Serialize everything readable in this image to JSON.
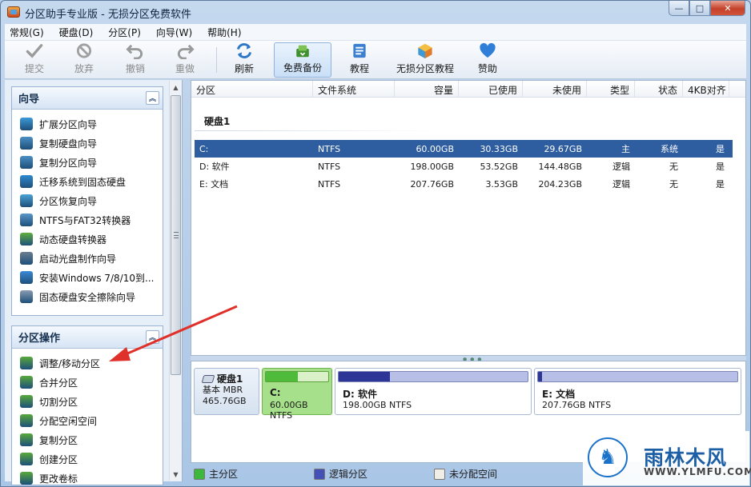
{
  "window": {
    "title": "分区助手专业版 - 无损分区免费软件",
    "min_glyph": "—",
    "max_glyph": "□",
    "close_glyph": "✕"
  },
  "menu": [
    "常规(G)",
    "硬盘(D)",
    "分区(P)",
    "向导(W)",
    "帮助(H)"
  ],
  "toolbar": {
    "commit": "提交",
    "discard": "放弃",
    "undo": "撤销",
    "redo": "重做",
    "refresh": "刷新",
    "backup": "免费备份",
    "tutorial": "教程",
    "lossless_tutorial": "无损分区教程",
    "donate": "赞助"
  },
  "wizard": {
    "title": "向导",
    "collapse_glyph": "︽",
    "items": [
      {
        "label": "扩展分区向导",
        "icon": "extend-partition-icon",
        "color": "#3d9ad8"
      },
      {
        "label": "复制硬盘向导",
        "icon": "copy-disk-icon",
        "color": "#4b8fc4"
      },
      {
        "label": "复制分区向导",
        "icon": "copy-partition-icon",
        "color": "#4b8fc4"
      },
      {
        "label": "迁移系统到固态硬盘",
        "icon": "migrate-ssd-icon",
        "color": "#2f8ad1"
      },
      {
        "label": "分区恢复向导",
        "icon": "partition-recovery-icon",
        "color": "#4aa3d6"
      },
      {
        "label": "NTFS与FAT32转换器",
        "icon": "ntfs-fat32-icon",
        "color": "#5a97c9"
      },
      {
        "label": "动态硬盘转换器",
        "icon": "dynamic-disk-icon",
        "color": "#5fae3c"
      },
      {
        "label": "启动光盘制作向导",
        "icon": "boot-cd-icon",
        "color": "#6c7d90"
      },
      {
        "label": "安装Windows 7/8/10到...",
        "icon": "windows-install-icon",
        "color": "#3b89d6"
      },
      {
        "label": "固态硬盘安全擦除向导",
        "icon": "ssd-erase-icon",
        "color": "#8a9bb0"
      }
    ]
  },
  "partition_ops": {
    "title": "分区操作",
    "collapse_glyph": "︽",
    "items": [
      {
        "label": "调整/移动分区",
        "icon": "resize-move-icon",
        "color": "#58a83a"
      },
      {
        "label": "合并分区",
        "icon": "merge-partition-icon",
        "color": "#58a83a"
      },
      {
        "label": "切割分区",
        "icon": "split-partition-icon",
        "color": "#58a83a"
      },
      {
        "label": "分配空闲空间",
        "icon": "allocate-space-icon",
        "color": "#58a83a"
      },
      {
        "label": "复制分区",
        "icon": "copy-partition-op-icon",
        "color": "#58a83a"
      },
      {
        "label": "创建分区",
        "icon": "create-partition-icon",
        "color": "#58a83a"
      },
      {
        "label": "更改卷标",
        "icon": "change-label-icon",
        "color": "#58a83a"
      }
    ]
  },
  "table": {
    "columns": [
      "分区",
      "文件系统",
      "容量",
      "已使用",
      "未使用",
      "类型",
      "状态",
      "4KB对齐"
    ],
    "disk_label": "硬盘1",
    "rows": [
      {
        "partition": "C:",
        "fs": "NTFS",
        "capacity": "60.00GB",
        "used": "30.33GB",
        "free": "29.67GB",
        "type": "主",
        "status": "系统",
        "align": "是"
      },
      {
        "partition": "D: 软件",
        "fs": "NTFS",
        "capacity": "198.00GB",
        "used": "53.52GB",
        "free": "144.48GB",
        "type": "逻辑",
        "status": "无",
        "align": "是"
      },
      {
        "partition": "E: 文档",
        "fs": "NTFS",
        "capacity": "207.76GB",
        "used": "3.53GB",
        "free": "204.23GB",
        "type": "逻辑",
        "status": "无",
        "align": "是"
      }
    ]
  },
  "diskmap": {
    "disk": {
      "name": "硬盘1",
      "type": "基本 MBR",
      "size": "465.76GB"
    },
    "partitions": [
      {
        "name": "C:",
        "info": "60.00GB NTFS",
        "used_fraction": 0.51,
        "fill": "#4fbb3a"
      },
      {
        "name": "D: 软件",
        "info": "198.00GB NTFS",
        "used_fraction": 0.27,
        "fill": "#2d3596"
      },
      {
        "name": "E: 文档",
        "info": "207.76GB NTFS",
        "used_fraction": 0.02,
        "fill": "#2d3596"
      }
    ]
  },
  "legend": {
    "primary": "主分区",
    "logical": "逻辑分区",
    "unallocated": "未分配空间",
    "colors": {
      "primary": "#3cb83a",
      "logical": "#4350b8",
      "unallocated": "#f0ede6"
    }
  },
  "watermark": {
    "brand": "雨林木风",
    "url": "WWW.YLMFU.COM"
  },
  "accent": "#e0302a"
}
